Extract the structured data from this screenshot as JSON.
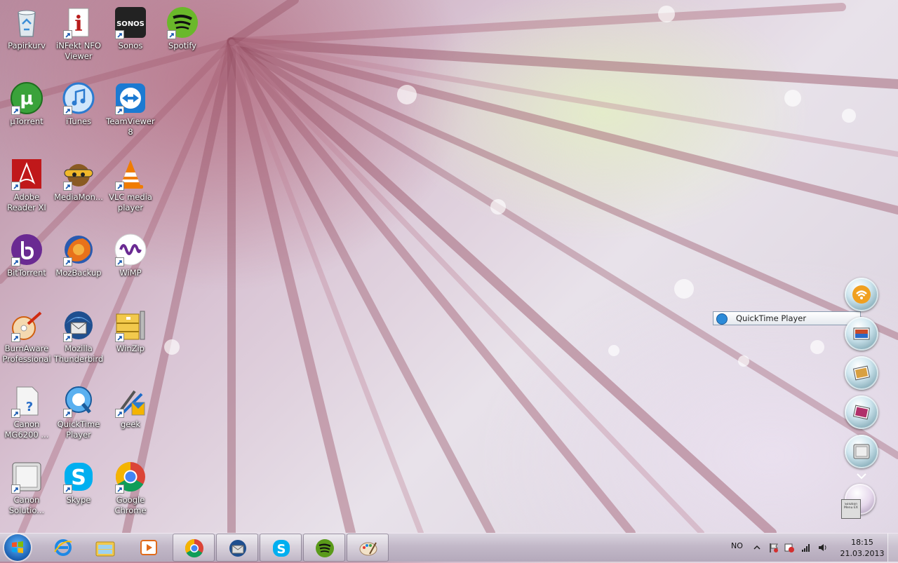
{
  "desktop_icons": [
    {
      "label": "Papirkurv",
      "icon": "recycle-bin-icon"
    },
    {
      "label": "iNFekt NFO Viewer",
      "icon": "nfo-viewer-icon"
    },
    {
      "label": "Sonos",
      "icon": "sonos-icon"
    },
    {
      "label": "Spotify",
      "icon": "spotify-icon"
    },
    {
      "label": "µTorrent",
      "icon": "utorrent-icon"
    },
    {
      "label": "iTunes",
      "icon": "itunes-icon"
    },
    {
      "label": "TeamViewer 8",
      "icon": "teamviewer-icon"
    },
    {
      "label": "Adobe Reader XI",
      "icon": "adobe-reader-icon"
    },
    {
      "label": "MediaMon...",
      "icon": "mediamonkey-icon"
    },
    {
      "label": "VLC media player",
      "icon": "vlc-icon"
    },
    {
      "label": "BitTorrent",
      "icon": "bittorrent-icon"
    },
    {
      "label": "MozBackup",
      "icon": "mozbackup-icon"
    },
    {
      "label": "WiMP",
      "icon": "wimp-icon"
    },
    {
      "label": "BurnAware Professional",
      "icon": "burnaware-icon"
    },
    {
      "label": "Mozilla Thunderbird",
      "icon": "thunderbird-icon"
    },
    {
      "label": "WinZip",
      "icon": "winzip-icon"
    },
    {
      "label": "Canon MG6200 ...",
      "icon": "canon-printer-icon"
    },
    {
      "label": "QuickTime Player",
      "icon": "quicktime-icon"
    },
    {
      "label": "geek",
      "icon": "geek-uninstaller-icon"
    },
    {
      "label": "Canon Solutio...",
      "icon": "canon-solution-icon"
    },
    {
      "label": "Skype",
      "icon": "skype-icon"
    },
    {
      "label": "Google Chrome",
      "icon": "chrome-icon"
    }
  ],
  "tooltip": {
    "text": "QuickTime Player"
  },
  "dock": {
    "items": [
      "wifi-icon",
      "photo-icon",
      "photo-icon",
      "photo-icon",
      "solution-menu-icon"
    ],
    "small_label": "Solution Menu EX"
  },
  "taskbar": {
    "pinned": [
      "internet-explorer-icon",
      "windows-explorer-icon",
      "media-player-icon"
    ],
    "running": [
      "chrome-icon",
      "thunderbird-icon",
      "skype-icon",
      "spotify-icon",
      "paint-icon"
    ]
  },
  "tray": {
    "language": "NO",
    "time": "18:15",
    "date": "21.03.2013"
  }
}
